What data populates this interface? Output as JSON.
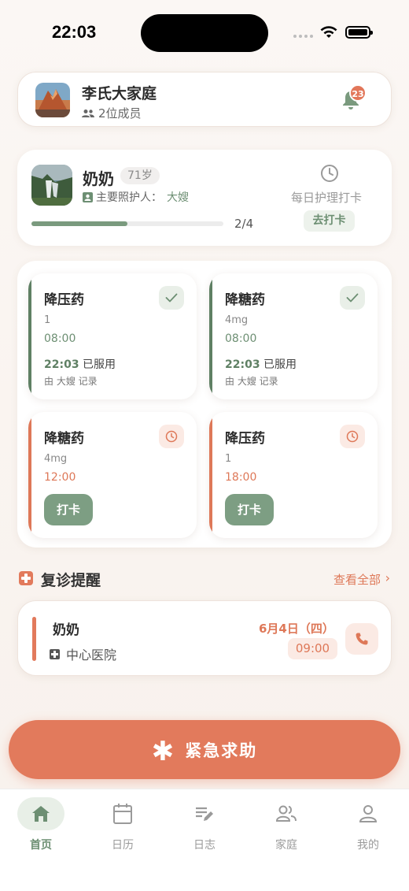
{
  "status_bar": {
    "time": "22:03"
  },
  "family": {
    "name": "李氏大家庭",
    "members": "2位成员",
    "notification_count": "23"
  },
  "patient": {
    "name": "奶奶",
    "age": "71岁",
    "caregiver_label": "主要照护人：",
    "caregiver_name": "大嫂",
    "progress_text": "2/4",
    "progress_fraction": 0.5,
    "daily_label": "每日护理打卡",
    "checkin_button": "去打卡"
  },
  "medications": [
    {
      "name": "降压药",
      "dose": "1",
      "time": "08:00",
      "status": "done",
      "taken_time": "22:03",
      "taken_label": "已服用",
      "recorded": "由 大嫂 记录"
    },
    {
      "name": "降糖药",
      "dose": "4mg",
      "time": "08:00",
      "status": "done",
      "taken_time": "22:03",
      "taken_label": "已服用",
      "recorded": "由 大嫂 记录"
    },
    {
      "name": "降糖药",
      "dose": "4mg",
      "time": "12:00",
      "status": "pending",
      "button": "打卡"
    },
    {
      "name": "降压药",
      "dose": "1",
      "time": "18:00",
      "status": "pending",
      "button": "打卡"
    }
  ],
  "followup": {
    "title": "复诊提醒",
    "view_all": "查看全部",
    "appointment": {
      "name": "奶奶",
      "hospital": "中心医院",
      "date": "6月4日（四）",
      "time": "09:00"
    }
  },
  "sos": {
    "label": "紧急求助"
  },
  "tabs": [
    {
      "label": "首页",
      "icon": "home-icon"
    },
    {
      "label": "日历",
      "icon": "calendar-icon"
    },
    {
      "label": "日志",
      "icon": "journal-icon"
    },
    {
      "label": "家庭",
      "icon": "family-icon"
    },
    {
      "label": "我的",
      "icon": "profile-icon"
    }
  ],
  "colors": {
    "accent_green": "#6d8f73",
    "accent_orange": "#e27a5c",
    "background": "#fbf7f4"
  }
}
